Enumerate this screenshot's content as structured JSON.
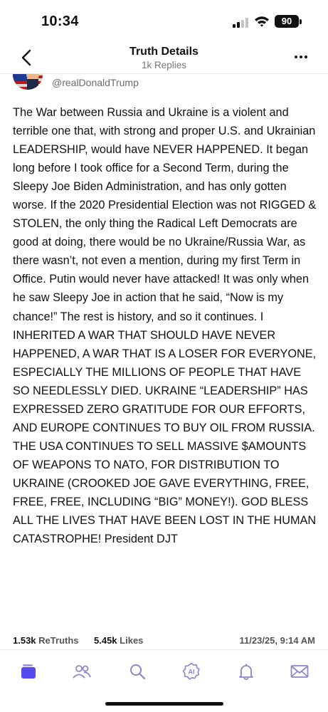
{
  "status_bar": {
    "time": "10:34",
    "battery": "90"
  },
  "header": {
    "title": "Truth Details",
    "subtitle": "1k Replies"
  },
  "post": {
    "handle": "@realDonaldTrump",
    "body": "The War between Russia and Ukraine is a violent and terrible one that, with strong and proper U.S. and Ukrainian LEADERSHIP, would have NEVER HAPPENED. It began long before I took office for a Second Term, during the Sleepy Joe Biden Administration, and has only gotten worse. If the 2020 Presidential Election was not RIGGED & STOLEN, the only thing the Radical Left Democrats are good at doing, there would be no Ukraine/Russia War, as there wasn’t, not even a mention, during my first Term in Office. Putin would never have attacked! It was only when he saw Sleepy Joe in action that he said, “Now is my chance!” The rest is history, and so it continues. I INHERITED A WAR THAT SHOULD HAVE NEVER HAPPENED, A WAR THAT IS A LOSER FOR EVERYONE, ESPECIALLY THE MILLIONS OF PEOPLE THAT HAVE SO NEEDLESSLY DIED. UKRAINE “LEADERSHIP” HAS EXPRESSED ZERO GRATITUDE FOR OUR EFFORTS, AND EUROPE CONTINUES TO BUY OIL FROM RUSSIA. THE USA CONTINUES TO SELL MASSIVE $AMOUNTS OF WEAPONS TO NATO, FOR DISTRIBUTION TO UKRAINE (CROOKED JOE GAVE EVERYTHING, FREE, FREE, FREE, INCLUDING “BIG” MONEY!). GOD BLESS ALL THE LIVES THAT HAVE BEEN LOST IN THE HUMAN CATASTROPHE! President DJT",
    "retruths_count": "1.53k",
    "retruths_label": "ReTruths",
    "likes_count": "5.45k",
    "likes_label": "Likes",
    "timestamp": "11/23/25, 9:14 AM"
  },
  "tab_bar": {
    "icons": [
      "home-icon",
      "people-icon",
      "search-icon",
      "ai-icon",
      "bell-icon",
      "mail-icon"
    ],
    "accent_color": "#5448ee",
    "icon_color": "#8a86c9"
  }
}
